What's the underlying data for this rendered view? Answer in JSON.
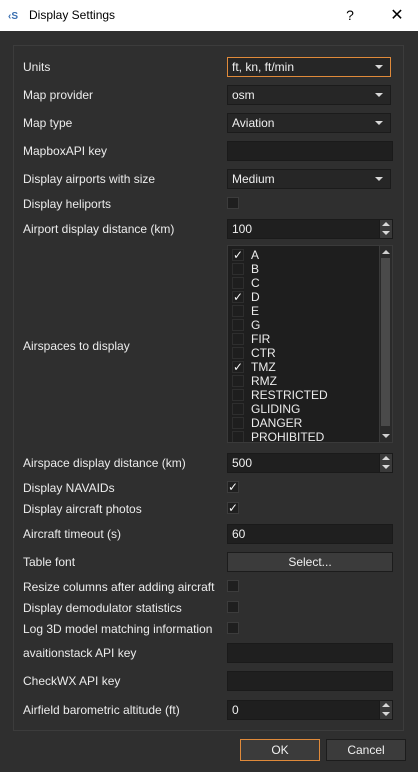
{
  "window": {
    "title": "Display Settings",
    "help": "?",
    "close": "✕"
  },
  "fields": {
    "units": {
      "label": "Units",
      "value": "ft, kn, ft/min"
    },
    "map_provider": {
      "label": "Map provider",
      "value": "osm"
    },
    "map_type": {
      "label": "Map type",
      "value": "Aviation"
    },
    "mapbox_key": {
      "label": "MapboxAPI key",
      "value": ""
    },
    "airport_size": {
      "label": "Display airports with size",
      "value": "Medium"
    },
    "heliports": {
      "label": "Display heliports",
      "checked": false
    },
    "airport_distance": {
      "label": "Airport display distance (km)",
      "value": "100"
    },
    "airspaces": {
      "label": "Airspaces to display"
    },
    "airspace_distance": {
      "label": "Airspace display distance (km)",
      "value": "500"
    },
    "navaids": {
      "label": "Display NAVAIDs",
      "checked": true
    },
    "aircraft_photos": {
      "label": "Display aircraft photos",
      "checked": true
    },
    "aircraft_timeout": {
      "label": "Aircraft timeout (s)",
      "value": "60"
    },
    "table_font": {
      "label": "Table font",
      "button": "Select..."
    },
    "resize_columns": {
      "label": "Resize columns after adding aircraft",
      "checked": false
    },
    "demod_stats": {
      "label": "Display demodulator statistics",
      "checked": false
    },
    "log_3d": {
      "label": "Log 3D model matching information",
      "checked": false
    },
    "aviationstack_key": {
      "label": "avaitionstack API key",
      "value": ""
    },
    "checkwx_key": {
      "label": "CheckWX API key",
      "value": ""
    },
    "barometric_alt": {
      "label": "Airfield barometric altitude (ft)",
      "value": "0"
    }
  },
  "airspace_items": [
    {
      "label": "A",
      "checked": true
    },
    {
      "label": "B",
      "checked": false
    },
    {
      "label": "C",
      "checked": false
    },
    {
      "label": "D",
      "checked": true
    },
    {
      "label": "E",
      "checked": false
    },
    {
      "label": "G",
      "checked": false
    },
    {
      "label": "FIR",
      "checked": false
    },
    {
      "label": "CTR",
      "checked": false
    },
    {
      "label": "TMZ",
      "checked": true
    },
    {
      "label": "RMZ",
      "checked": false
    },
    {
      "label": "RESTRICTED",
      "checked": false
    },
    {
      "label": "GLIDING",
      "checked": false
    },
    {
      "label": "DANGER",
      "checked": false
    },
    {
      "label": "PROHIBITED",
      "checked": false
    }
  ],
  "buttons": {
    "ok": "OK",
    "cancel": "Cancel"
  },
  "colors": {
    "accent": "#e08a3a",
    "background": "#2f2f2f",
    "field": "#1f1f1f"
  }
}
